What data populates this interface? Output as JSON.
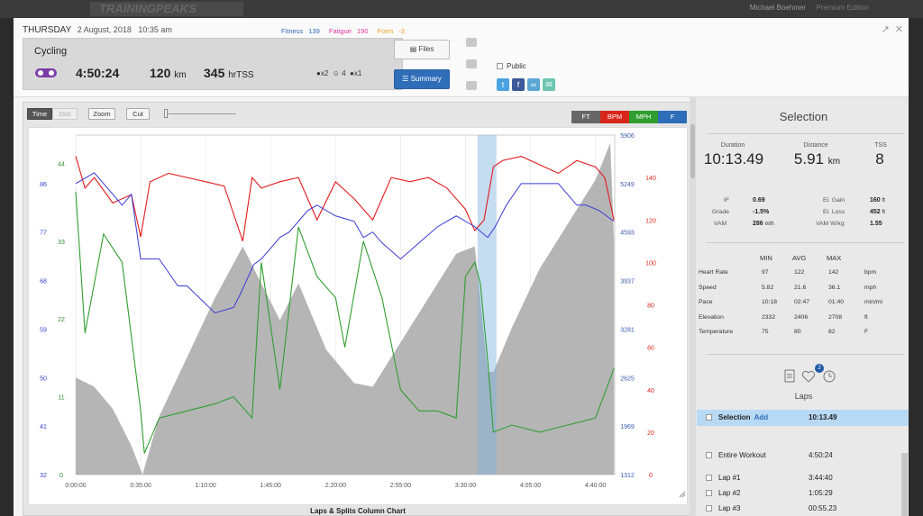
{
  "topbar": {
    "logo": "TRAININGPEAKS",
    "user": "Michael Boehmer",
    "premium": "Premium Edition"
  },
  "header": {
    "day": "THURSDAY",
    "date": "2 August, 2018",
    "time": "10:35 am",
    "metrics": {
      "fitness_label": "Fitness",
      "fitness": "139",
      "fatigue_label": "Fatigue",
      "fatigue": "190",
      "form_label": "Form",
      "form": "-3"
    },
    "card": {
      "sport": "Cycling",
      "duration": "4:50:24",
      "distance": "120",
      "distance_unit": "km",
      "tss": "345",
      "tss_unit": "hrTSS",
      "medals": "x2",
      "emoji_count": "4",
      "comments": "x1"
    },
    "files_label": "Files",
    "summary_label": "Summary",
    "public_label": "Public"
  },
  "toolbar": {
    "time": "Time",
    "dist": "Dist",
    "zoom": "Zoom",
    "cut": "Cut"
  },
  "legend": {
    "ft": "FT",
    "bpm": "BPM",
    "mph": "MPH",
    "f": "F"
  },
  "colors": {
    "hr": "#e31a1c",
    "speed": "#2f9e2f",
    "temp": "#3a3ad8",
    "elev": "#a8a8a8",
    "accent": "#2f6db8"
  },
  "chart_data": {
    "type": "line",
    "title": "",
    "caption": "Laps & Splits Column Chart",
    "x_ticks": [
      "0:00:00",
      "0:35:00",
      "1:10:00",
      "1:45:00",
      "2:20:00",
      "2:55:00",
      "3:30:00",
      "4:05:00",
      "4:40:00"
    ],
    "x_range_min": [
      0,
      290.4
    ],
    "selection_range_min": [
      216.5,
      226.7
    ],
    "axes": {
      "left_temp_F": {
        "ticks": [
          32,
          41,
          50,
          59,
          68,
          77,
          86
        ],
        "range": [
          32,
          95
        ]
      },
      "left_speed_mph": {
        "ticks": [
          0,
          11,
          22,
          33,
          44
        ],
        "range": [
          0,
          48
        ]
      },
      "right_elev_ft": {
        "ticks": [
          1312,
          1969,
          2625,
          3281,
          3937,
          4593,
          5249,
          5906
        ],
        "range": [
          1312,
          5906
        ]
      },
      "right_hr_bpm": {
        "ticks": [
          0,
          20,
          40,
          60,
          80,
          100,
          120,
          140
        ],
        "range": [
          0,
          160
        ]
      }
    },
    "series": [
      {
        "name": "FT",
        "axis": "right_elev_ft",
        "x": [
          0,
          10,
          20,
          30,
          36,
          45,
          60,
          75,
          90,
          100,
          110,
          120,
          135,
          150,
          160,
          165,
          175,
          190,
          205,
          215,
          222,
          225,
          235,
          250,
          265,
          280,
          288,
          290
        ],
        "y": [
          2625,
          2500,
          2200,
          1700,
          1312,
          2100,
          2900,
          3700,
          4400,
          3900,
          3400,
          3900,
          3000,
          2550,
          2500,
          2700,
          3100,
          3700,
          4300,
          4400,
          2700,
          2700,
          3300,
          4100,
          4700,
          5300,
          5800,
          4500
        ]
      },
      {
        "name": "BPM",
        "axis": "right_hr_bpm",
        "x": [
          0,
          5,
          10,
          20,
          30,
          35,
          40,
          50,
          60,
          70,
          80,
          90,
          95,
          100,
          110,
          120,
          130,
          140,
          150,
          160,
          170,
          180,
          190,
          200,
          205,
          210,
          215,
          220,
          225,
          230,
          240,
          250,
          260,
          270,
          280,
          285,
          290
        ],
        "y": [
          150,
          135,
          140,
          128,
          132,
          112,
          138,
          142,
          140,
          138,
          136,
          110,
          140,
          135,
          138,
          140,
          120,
          138,
          130,
          120,
          140,
          138,
          140,
          135,
          130,
          125,
          115,
          120,
          145,
          148,
          150,
          146,
          142,
          148,
          145,
          140,
          120
        ]
      },
      {
        "name": "MPH",
        "axis": "left_speed_mph",
        "x": [
          0,
          5,
          15,
          25,
          35,
          37,
          45,
          60,
          75,
          85,
          95,
          100,
          110,
          120,
          130,
          140,
          145,
          155,
          165,
          175,
          185,
          195,
          205,
          210,
          215,
          218,
          222,
          225,
          235,
          250,
          265,
          280,
          290
        ],
        "y": [
          40,
          20,
          34,
          30,
          9,
          3,
          8,
          9,
          10,
          11,
          8,
          30,
          12,
          35,
          28,
          25,
          18,
          33,
          25,
          12,
          9,
          9,
          8,
          28,
          30,
          27,
          16,
          6,
          7,
          6,
          7,
          8,
          15
        ]
      },
      {
        "name": "F",
        "axis": "left_temp_F",
        "x": [
          0,
          10,
          20,
          25,
          30,
          35,
          45,
          55,
          60,
          75,
          85,
          88,
          92,
          96,
          100,
          105,
          110,
          115,
          120,
          125,
          130,
          140,
          150,
          155,
          160,
          165,
          175,
          185,
          195,
          205,
          215,
          222,
          226,
          232,
          240,
          250,
          260,
          265,
          270,
          275,
          282,
          290
        ],
        "y": [
          86,
          88,
          84,
          82,
          84,
          72,
          72,
          67,
          67,
          62,
          63,
          65,
          68,
          71,
          72,
          74,
          76,
          77,
          79,
          81,
          82,
          80,
          79,
          76,
          77,
          75,
          72,
          75,
          78,
          80,
          78,
          76,
          78,
          82,
          86,
          86,
          86,
          84,
          82,
          82,
          81,
          79
        ]
      }
    ]
  },
  "selection": {
    "title": "Selection",
    "duration_label": "Duration",
    "duration": "10:13.49",
    "distance_label": "Distance",
    "distance": "5.91",
    "distance_unit": "km",
    "tss_label": "TSS",
    "tss": "8",
    "if_label": "IF",
    "if": "0.69",
    "grade_label": "Grade",
    "grade": "-1.5%",
    "vam_label": "VAM",
    "vam": "286",
    "vam_unit": "m/h",
    "el_gain_label": "El. Gain",
    "el_gain": "160",
    "el_gain_unit": "ft",
    "el_loss_label": "El. Loss",
    "el_loss": "452",
    "el_loss_unit": "ft",
    "vamwkg_label": "VAM W/kg",
    "vamwkg": "1.55",
    "metrics_header": [
      "MIN",
      "AVG",
      "MAX"
    ],
    "metrics": [
      {
        "label": "Heart Rate",
        "min": "97",
        "avg": "122",
        "max": "142",
        "unit": "bpm"
      },
      {
        "label": "Speed",
        "min": "5.82",
        "avg": "21.6",
        "max": "36.1",
        "unit": "mph"
      },
      {
        "label": "Pace",
        "min": "10:18",
        "avg": "02:47",
        "max": "01:40",
        "unit": "min/mi"
      },
      {
        "label": "Elevation",
        "min": "2332",
        "avg": "2406",
        "max": "2708",
        "unit": "ft"
      },
      {
        "label": "Temperature",
        "min": "75",
        "avg": "80",
        "max": "82",
        "unit": "F"
      }
    ]
  },
  "laps": {
    "badge": "2",
    "title": "Laps",
    "selection_row": {
      "name": "Selection",
      "add": "Add",
      "time": "10:13.49"
    },
    "rows": [
      {
        "name": "Entire Workout",
        "time": "4:50:24"
      },
      {
        "name": "Lap #1",
        "time": "3:44:40"
      },
      {
        "name": "Lap #2",
        "time": "1:05:29"
      },
      {
        "name": "Lap #3",
        "time": "00:55.23"
      }
    ]
  }
}
